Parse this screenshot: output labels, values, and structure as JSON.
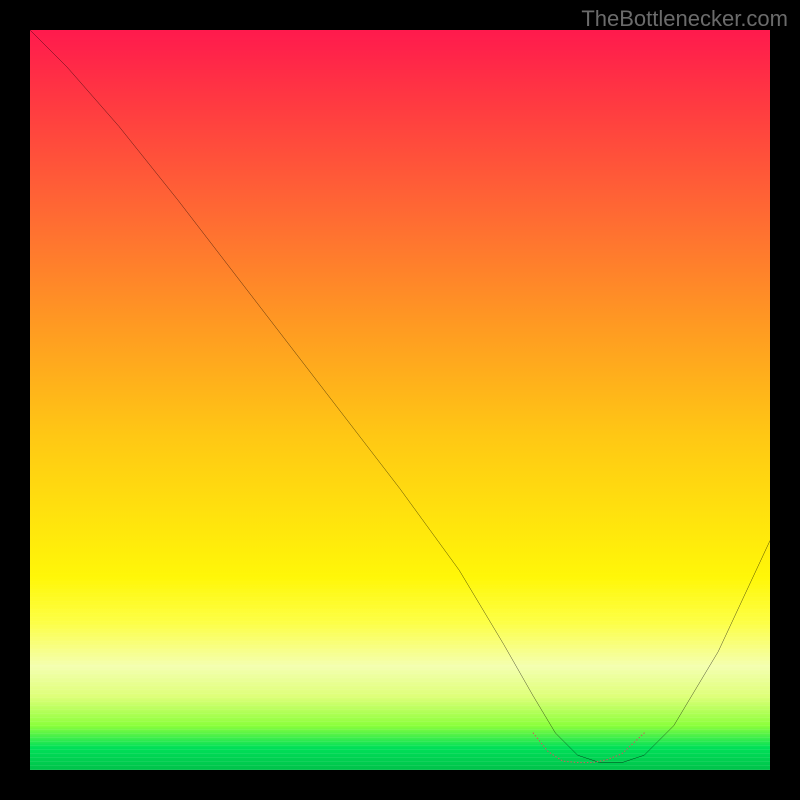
{
  "watermark": "TheBottlenecker.com",
  "chart_data": {
    "type": "line",
    "title": "",
    "xlabel": "",
    "ylabel": "",
    "xlim": [
      0,
      100
    ],
    "ylim": [
      0,
      100
    ],
    "series": [
      {
        "name": "bottleneck-curve",
        "color": "#000000",
        "x": [
          0,
          5,
          12,
          20,
          30,
          40,
          50,
          58,
          64,
          68,
          71,
          74,
          77,
          80,
          83,
          87,
          93,
          100
        ],
        "y": [
          100,
          95,
          87,
          77,
          64,
          51,
          38,
          27,
          17,
          10,
          5,
          2,
          1,
          1,
          2,
          6,
          16,
          31
        ]
      },
      {
        "name": "optimal-range-marker",
        "color": "#cc5b5b",
        "x": [
          68,
          70,
          72,
          74,
          76,
          78,
          80,
          83
        ],
        "y": [
          5,
          2.5,
          1.2,
          1.0,
          1.0,
          1.4,
          2.2,
          5
        ]
      }
    ],
    "notes": "Values are relative (0-100) estimates read from an unlabeled bottleneck-style heatmap plot; y is bottleneck percentage (lower = better), x is relative component tier. Curve falls from top-left, reaches a flat minimum around x≈73-80, then rises toward the right edge."
  },
  "colors": {
    "page_bg": "#000000",
    "gradient_top": "#ff1a4d",
    "gradient_mid": "#fff708",
    "gradient_bot": "#00c24a",
    "curve": "#000000",
    "marker": "#cc5b5b",
    "watermark": "#6b6b6b"
  }
}
